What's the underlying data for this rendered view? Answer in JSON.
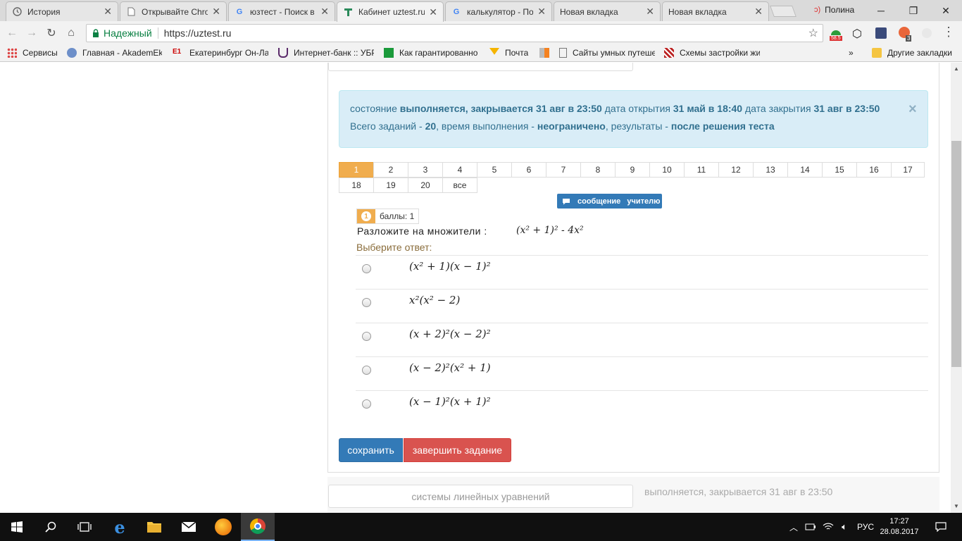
{
  "browser": {
    "tabs": [
      {
        "title": "История",
        "icon": "history-icon"
      },
      {
        "title": "Открывайте Chrome",
        "icon": "page-icon"
      },
      {
        "title": "юзтест - Поиск в",
        "icon": "google-icon"
      },
      {
        "title": "Кабинет uztest.ru",
        "icon": "uztest-icon",
        "active": true
      },
      {
        "title": "калькулятор - По",
        "icon": "google-icon"
      },
      {
        "title": "Новая вкладка",
        "icon": ""
      },
      {
        "title": "Новая вкладка",
        "icon": ""
      }
    ],
    "profile_name": "Полина",
    "secure_label": "Надежный",
    "url": "https://uztest.ru",
    "ext_badge_1": "58.5",
    "ext_badge_2": "3",
    "bookmarks": [
      {
        "label": "Сервисы"
      },
      {
        "label": "Главная - AkademEk"
      },
      {
        "label": "Екатеринбург Он-Ла"
      },
      {
        "label": "Интернет-банк :: УБР"
      },
      {
        "label": "Как гарантированно"
      },
      {
        "label": "Почта"
      },
      {
        "label": ""
      },
      {
        "label": "Сайты умных путеше"
      },
      {
        "label": "Схемы застройки жи"
      }
    ],
    "more_bookmarks": "»",
    "other_bookmarks": "Другие закладки"
  },
  "page": {
    "alert": {
      "line1_a": "состояние",
      "line1_b": "выполняется, закрывается 31 авг в 23:50",
      "line1_c": "дата открытия",
      "line1_d": "31 май в 18:40",
      "line1_e": "дата закрытия",
      "line1_f": "31 авг в 23:50",
      "line2_a": "Всего заданий -",
      "line2_b": "20",
      "line2_c": ", время выполнения -",
      "line2_d": "неограничено",
      "line2_e": ", результаты -",
      "line2_f": "после решения теста",
      "close": "×"
    },
    "questions": [
      "1",
      "2",
      "3",
      "4",
      "5",
      "6",
      "7",
      "8",
      "9",
      "10",
      "11",
      "12",
      "13",
      "14",
      "15",
      "16",
      "17",
      "18",
      "19",
      "20",
      "все"
    ],
    "active_question": "1",
    "message_button": "сообщение учителю",
    "question": {
      "number": "1",
      "points": "баллы: 1",
      "prompt": "Разложите на множители :",
      "prompt_formula": "(x² + 1)² - 4x²",
      "choose_label": "Выберите ответ:",
      "answers": [
        "(x² + 1)(x − 1)²",
        "x²(x² − 2)",
        "(x + 2)²(x − 2)²",
        "(x − 2)²(x² + 1)",
        "(x − 1)²(x + 1)²"
      ]
    },
    "save_button": "сохранить",
    "finish_button": "завершить задание",
    "next_test": {
      "title": "системы линейных уравнений",
      "status": "выполняется, закрывается 31 авг в 23:50"
    }
  },
  "taskbar": {
    "language": "РУС",
    "time": "17:27",
    "date": "28.08.2017"
  },
  "colors": {
    "alert_bg": "#d9edf7",
    "alert_text": "#31708f",
    "active_question": "#f0ad4e",
    "primary": "#337ab7",
    "danger": "#d9534f",
    "taskbar": "#101010"
  }
}
